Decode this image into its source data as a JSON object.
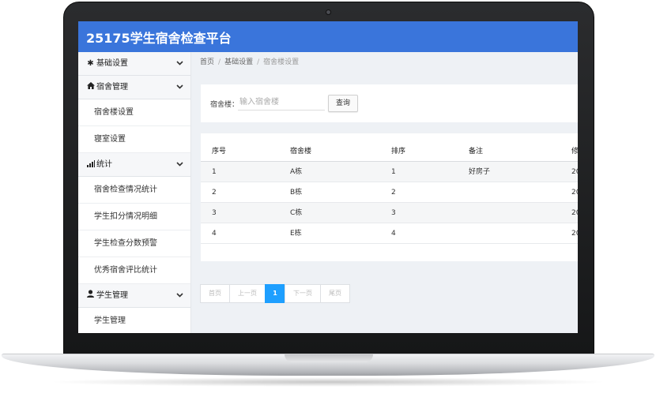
{
  "app": {
    "title": "25175学生宿舍检查平台"
  },
  "sidebar": {
    "groups": [
      {
        "label": "基础设置",
        "icon": "gear-icon",
        "items": []
      },
      {
        "label": "宿舍管理",
        "icon": "home-icon",
        "items": [
          {
            "label": "宿舍楼设置"
          },
          {
            "label": "寝室设置"
          }
        ]
      },
      {
        "label": "统计",
        "icon": "bar-chart-icon",
        "items": [
          {
            "label": "宿舍检查情况统计"
          },
          {
            "label": "学生扣分情况明细"
          },
          {
            "label": "学生检查分数预警"
          },
          {
            "label": "优秀宿舍评比统计"
          }
        ]
      },
      {
        "label": "学生管理",
        "icon": "user-icon",
        "items": [
          {
            "label": "学生管理"
          }
        ]
      }
    ]
  },
  "breadcrumb": {
    "home": "首页",
    "section": "基础设置",
    "current": "宿舍楼设置"
  },
  "search": {
    "label": "宿舍楼：",
    "placeholder": "输入宿舍楼",
    "button": "查询"
  },
  "table": {
    "headers": [
      "序号",
      "宿舍楼",
      "排序",
      "备注",
      "修"
    ],
    "rows": [
      [
        "1",
        "A栋",
        "1",
        "好房子",
        "20"
      ],
      [
        "2",
        "B栋",
        "2",
        "",
        "20"
      ],
      [
        "3",
        "C栋",
        "3",
        "",
        "20"
      ],
      [
        "4",
        "E栋",
        "4",
        "",
        "20"
      ]
    ]
  },
  "pagination": {
    "first": "首页",
    "prev": "上一页",
    "current": "1",
    "next": "下一页",
    "last": "尾页"
  },
  "colors": {
    "header": "#3a75db",
    "active_page": "#1e9fff"
  }
}
